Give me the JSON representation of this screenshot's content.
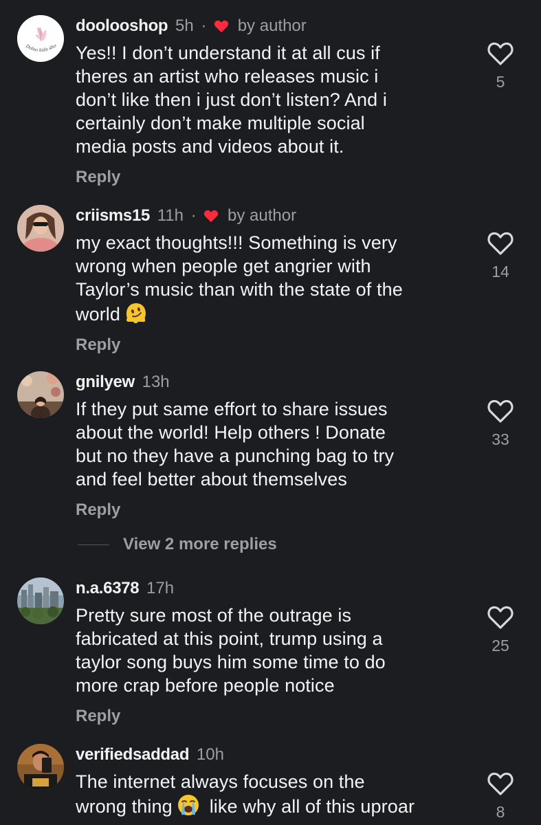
{
  "comments": [
    {
      "username": "doolooshop",
      "time": "5h",
      "liked_by_author": true,
      "by_author_label": "by author",
      "text_lines": [
        "Yes!! I don’t understand it at all cus if",
        "theres an artist who releases music i",
        "don’t like then i just don’t listen? And i",
        "certainly don’t make multiple social",
        "media posts and videos about it."
      ],
      "reply_label": "Reply",
      "likes": "5",
      "avatar": "doolooshop-logo-avatar"
    },
    {
      "username": "criisms15",
      "time": "11h",
      "liked_by_author": true,
      "by_author_label": "by author",
      "text_lines": [
        "my exact thoughts!!! Something is very",
        "wrong when people get angrier with",
        "Taylor’s music than with the state of the",
        "world"
      ],
      "emoji": "melting-face-emoji",
      "reply_label": "Reply",
      "likes": "14",
      "avatar": "profile-photo-avatar"
    },
    {
      "username": "gnilyew",
      "time": "13h",
      "liked_by_author": false,
      "text_lines": [
        "If they put same effort to share issues",
        "about the world! Help others ! Donate",
        "but no they have a punching bag to try",
        "and feel better about themselves"
      ],
      "reply_label": "Reply",
      "likes": "33",
      "avatar": "profile-photo-avatar",
      "view_more_label": "View 2 more replies"
    },
    {
      "username": "n.a.6378",
      "time": "17h",
      "liked_by_author": false,
      "text_lines": [
        "Pretty sure most of the outrage is",
        "fabricated at this point, trump using a",
        "taylor song buys him some time to do",
        "more crap before people notice"
      ],
      "reply_label": "Reply",
      "likes": "25",
      "avatar": "cityscape-photo-avatar"
    },
    {
      "username": "verifiedsaddad",
      "time": "10h",
      "liked_by_author": false,
      "text_lines": [
        "The internet always focuses on the",
        "wrong thing",
        "like why all of this uproar"
      ],
      "emoji": "loudly-crying-face-emoji",
      "likes": "8",
      "avatar": "selfie-photo-avatar"
    }
  ],
  "colors": {
    "background": "#1c1d20",
    "text": "#f2f2f2",
    "secondary": "#9d9fa5",
    "heart_red": "#ff2a3c"
  }
}
